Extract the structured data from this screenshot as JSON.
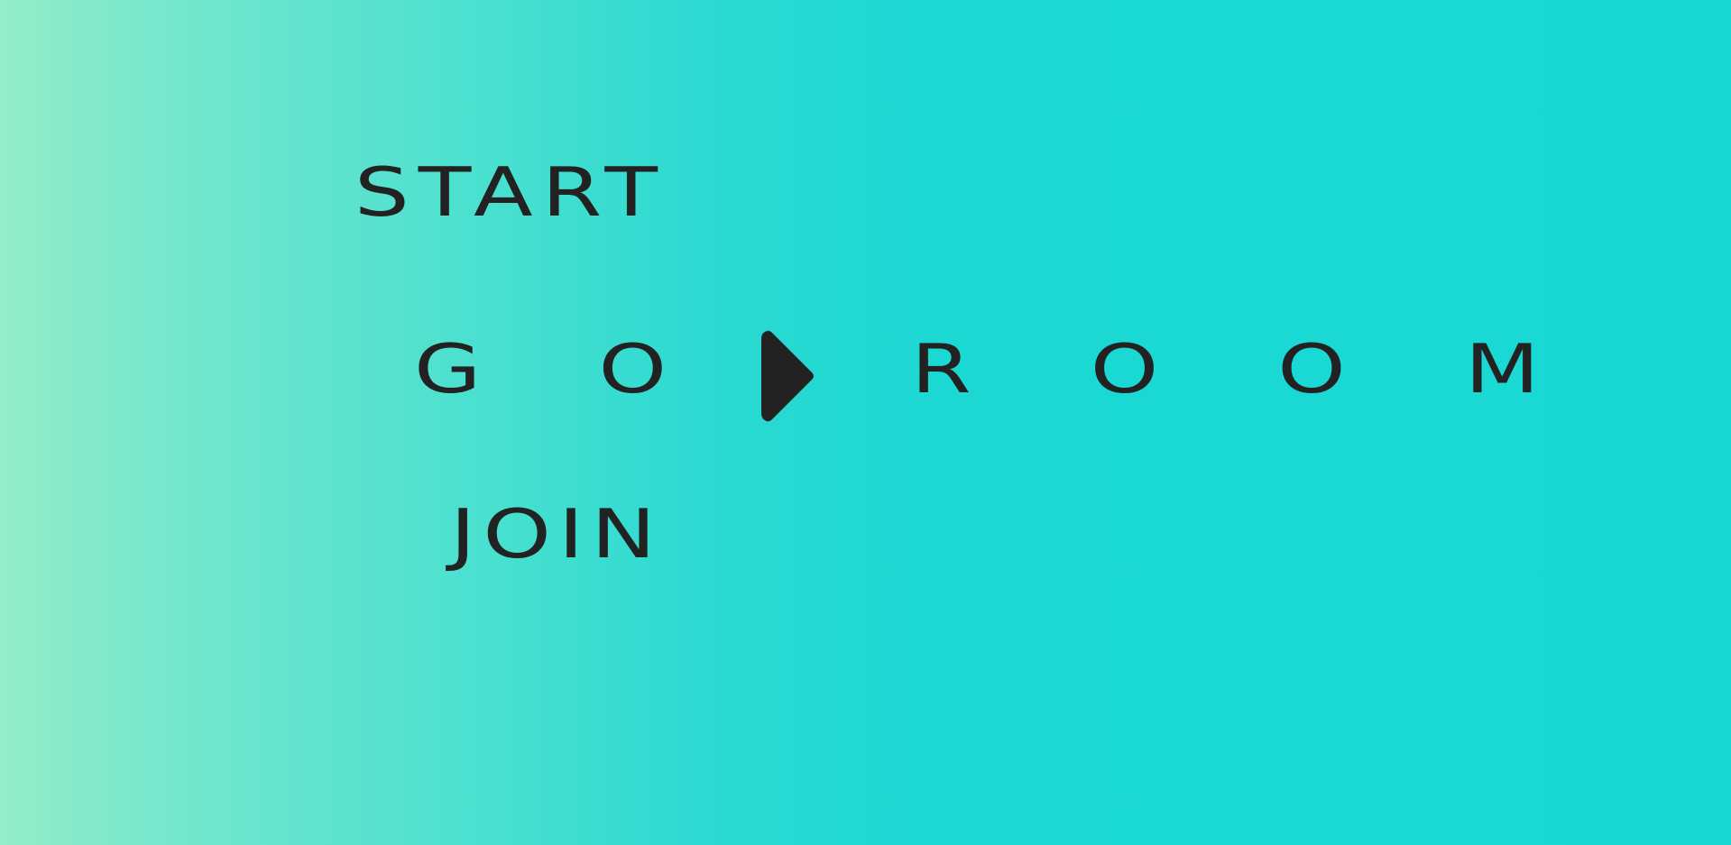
{
  "background": {
    "gradient_start": "#93edc8",
    "gradient_end": "#19d8d3"
  },
  "menu": {
    "items": [
      {
        "label": "START"
      },
      {
        "label": "GO"
      },
      {
        "label": "JOIN"
      }
    ]
  },
  "selection": {
    "indicator_icon": "triangle-right-icon",
    "selected_value": "ROOM"
  },
  "colors": {
    "text": "#222222"
  }
}
